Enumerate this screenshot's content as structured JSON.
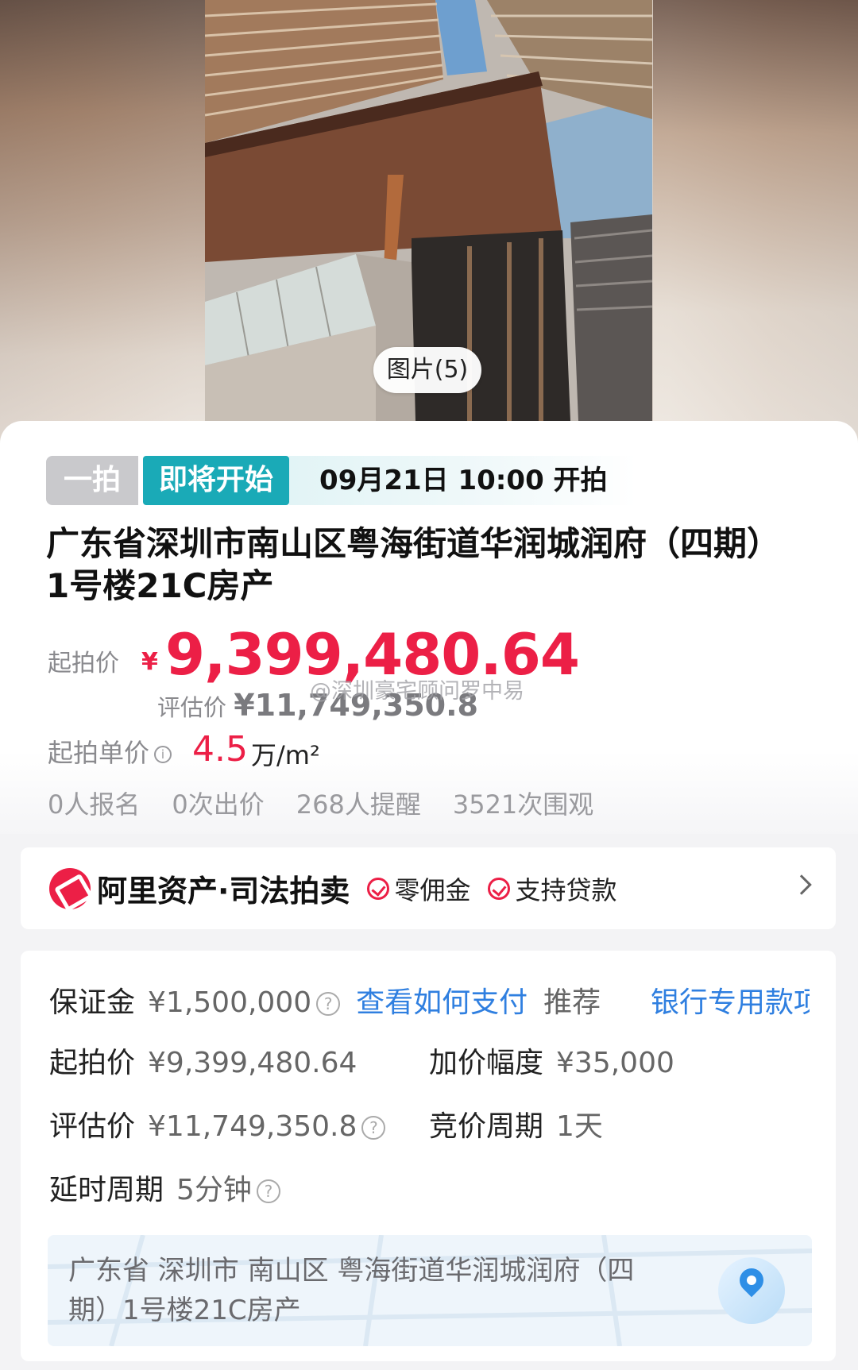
{
  "hero": {
    "image_count_label": "图片(5)"
  },
  "auction": {
    "round_tag": "一拍",
    "status_tag": "即将开始",
    "start_time": "09月21日 10:00 开拍",
    "title": "广东省深圳市南山区粤海街道华润城润府（四期）1号楼21C房产",
    "start_price_label": "起拍价",
    "currency_symbol": "¥",
    "start_price": "9,399,480.64",
    "eval_label": "评估价",
    "eval_price": "¥11,749,350.8",
    "watermark": "@深圳豪宅顾问罗中易",
    "unit_price_label": "起拍单价",
    "unit_price": "4.5",
    "unit_price_suffix": "万/m²",
    "stats": [
      "0人报名",
      "0次出价",
      "268人提醒",
      "3521次围观"
    ]
  },
  "platform": {
    "brand": "阿里资产·司法拍卖",
    "features": [
      "零佣金",
      "支持贷款"
    ]
  },
  "details": {
    "deposit_label": "保证金",
    "deposit_value": "¥1,500,000",
    "pay_link": "查看如何支付",
    "recommend_label": "推荐",
    "bank_link": "银行专用款项",
    "start_label": "起拍价",
    "start_value": "¥9,399,480.64",
    "increment_label": "加价幅度",
    "increment_value": "¥35,000",
    "eval_label": "评估价",
    "eval_value": "¥11,749,350.8",
    "cycle_label": "竞价周期",
    "cycle_value": "1天",
    "delay_label": "延时周期",
    "delay_value": "5分钟",
    "address": "广东省 深圳市 南山区 粤海街道华润城润府（四期）1号楼21C房产"
  },
  "colors": {
    "accent_red": "#ec1f46",
    "teal": "#1aaab7",
    "link_blue": "#2f7fe0"
  }
}
